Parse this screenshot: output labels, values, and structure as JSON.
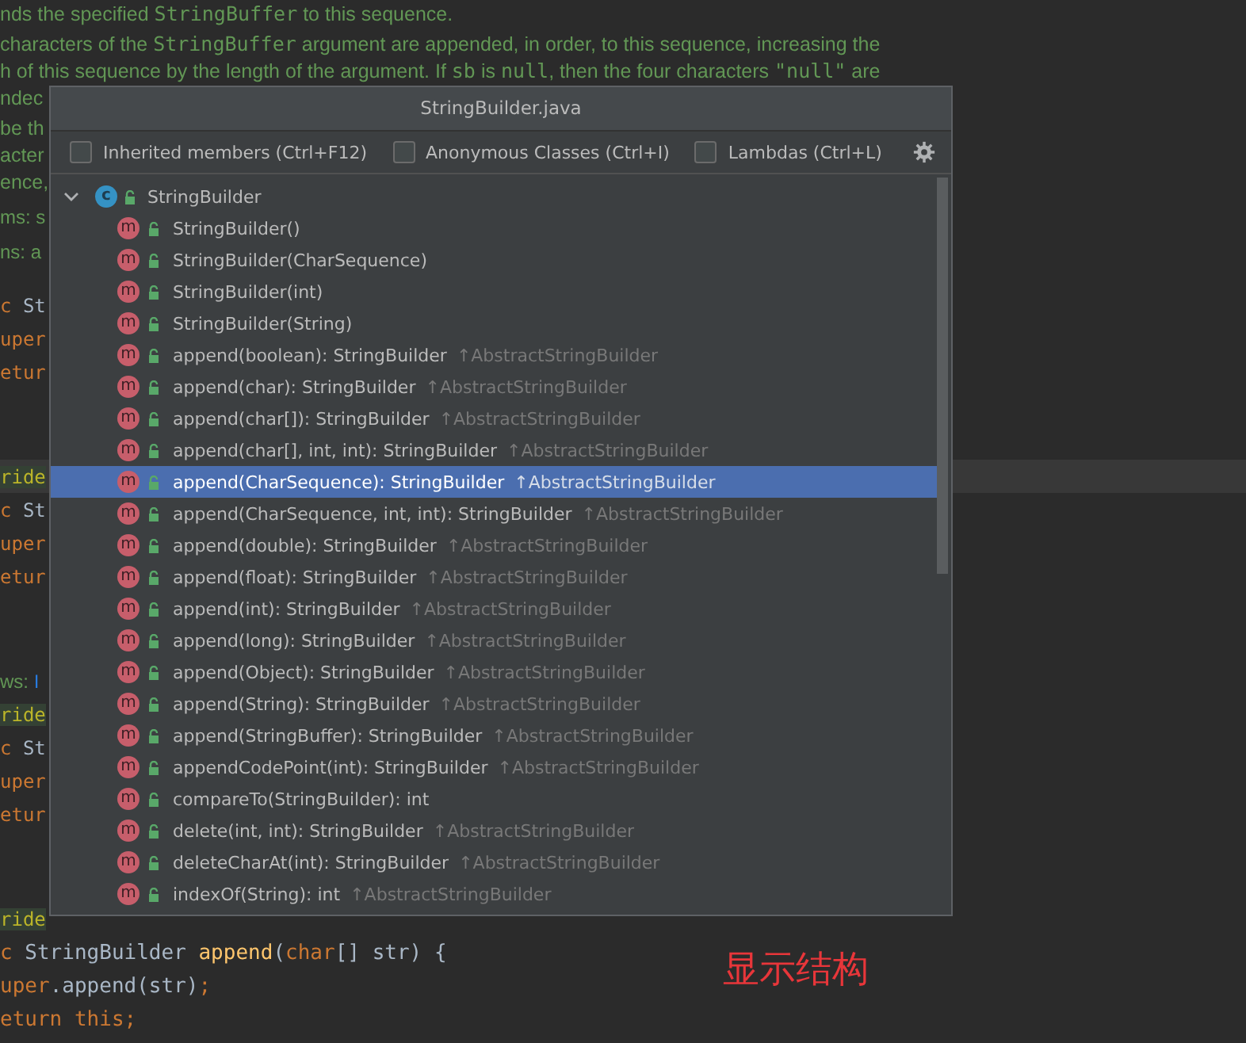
{
  "editor": {
    "blocks": [
      {
        "kind": "doc",
        "lines": [
          {
            "current": false,
            "segments": [
              {
                "text": "nds the specified ",
                "kind": "doc"
              },
              {
                "text": "StringBuffer",
                "kind": "doc-code"
              },
              {
                "text": " to this sequence.",
                "kind": "doc"
              }
            ]
          }
        ]
      },
      {
        "kind": "doc",
        "lines": [
          {
            "current": false,
            "segments": [
              {
                "text": "characters of the ",
                "kind": "doc"
              },
              {
                "text": "StringBuffer",
                "kind": "doc-code"
              },
              {
                "text": " argument are appended, in order, to this sequence, increasing the",
                "kind": "doc"
              }
            ]
          },
          {
            "current": false,
            "segments": [
              {
                "text": "h of this sequence by the length of the argument. If ",
                "kind": "doc"
              },
              {
                "text": "sb",
                "kind": "doc-code"
              },
              {
                "text": " is ",
                "kind": "doc"
              },
              {
                "text": "null",
                "kind": "doc-code"
              },
              {
                "text": ", then the four characters ",
                "kind": "doc"
              },
              {
                "text": "\"null\"",
                "kind": "doc-code"
              },
              {
                "text": " are",
                "kind": "doc"
              }
            ]
          },
          {
            "current": false,
            "segments": [
              {
                "text": "ndec",
                "kind": "doc"
              }
            ]
          }
        ]
      },
      {
        "kind": "doc",
        "lines": [
          {
            "current": false,
            "segments": [
              {
                "text": "be th",
                "kind": "doc"
              }
            ]
          },
          {
            "current": false,
            "segments": [
              {
                "text": "acter",
                "kind": "doc"
              }
            ]
          },
          {
            "current": false,
            "segments": [
              {
                "text": "ence,",
                "kind": "doc"
              }
            ]
          }
        ]
      },
      {
        "kind": "doc",
        "lines": [
          {
            "current": false,
            "segments": [
              {
                "text": "ms: s",
                "kind": "doc-tag"
              }
            ]
          }
        ]
      },
      {
        "kind": "doc",
        "lines": [
          {
            "current": false,
            "segments": [
              {
                "text": "ns: a",
                "kind": "doc-tag"
              }
            ]
          }
        ]
      },
      {
        "kind": "code",
        "lines": [
          {
            "current": false,
            "segments": [
              {
                "text": "c ",
                "kind": "keyword"
              },
              {
                "text": "St",
                "kind": "plain"
              }
            ]
          },
          {
            "current": false,
            "segments": [
              {
                "text": "uper",
                "kind": "keyword"
              }
            ]
          },
          {
            "current": false,
            "segments": [
              {
                "text": "etur",
                "kind": "keyword"
              }
            ]
          }
        ]
      },
      {
        "kind": "code",
        "lines": [
          {
            "current": true,
            "segments": [
              {
                "text": "ride",
                "kind": "annotation"
              }
            ]
          },
          {
            "current": false,
            "segments": [
              {
                "text": "c ",
                "kind": "keyword"
              },
              {
                "text": "St",
                "kind": "plain"
              }
            ]
          },
          {
            "current": false,
            "segments": [
              {
                "text": "uper",
                "kind": "keyword"
              }
            ]
          },
          {
            "current": false,
            "segments": [
              {
                "text": "etur",
                "kind": "keyword"
              }
            ]
          }
        ]
      },
      {
        "kind": "code",
        "lines": [
          {
            "current": false,
            "segments": [
              {
                "text": "ws: ",
                "kind": "doc-tag"
              },
              {
                "text": "I",
                "kind": "link"
              }
            ]
          },
          {
            "current": false,
            "segments": [
              {
                "text": "ride",
                "kind": "annotation"
              }
            ]
          },
          {
            "current": false,
            "segments": [
              {
                "text": "c ",
                "kind": "keyword"
              },
              {
                "text": "St",
                "kind": "plain"
              }
            ]
          },
          {
            "current": false,
            "segments": [
              {
                "text": "uper",
                "kind": "keyword"
              }
            ]
          },
          {
            "current": false,
            "segments": [
              {
                "text": "etur",
                "kind": "keyword"
              }
            ]
          }
        ]
      },
      {
        "kind": "code",
        "lines": [
          {
            "current": false,
            "segments": [
              {
                "text": "ride",
                "kind": "annotation"
              }
            ]
          },
          {
            "current": false,
            "segments": [
              {
                "text": "c ",
                "kind": "keyword"
              },
              {
                "text": "StringBuilder ",
                "kind": "plain"
              },
              {
                "text": "append",
                "kind": "method"
              },
              {
                "text": "(",
                "kind": "plain"
              },
              {
                "text": "char",
                "kind": "keyword"
              },
              {
                "text": "[] str) {",
                "kind": "plain"
              }
            ]
          },
          {
            "current": false,
            "segments": [
              {
                "text": "uper",
                "kind": "keyword"
              },
              {
                "text": ".append(str)",
                "kind": "plain"
              },
              {
                "text": ";",
                "kind": "keyword"
              }
            ]
          },
          {
            "current": false,
            "segments": [
              {
                "text": "eturn this",
                "kind": "keyword"
              },
              {
                "text": ";",
                "kind": "keyword"
              }
            ]
          }
        ]
      }
    ]
  },
  "annotation": "显示结构",
  "popup": {
    "title": "StringBuilder.java",
    "options": [
      {
        "label": "Inherited members (Ctrl+F12)",
        "checked": false
      },
      {
        "label": "Anonymous Classes (Ctrl+I)",
        "checked": false
      },
      {
        "label": "Lambdas (Ctrl+L)",
        "checked": false
      }
    ],
    "tree": {
      "kind": "class",
      "icon": "c",
      "label": "StringBuilder",
      "expanded": true,
      "children": [
        {
          "kind": "method",
          "icon": "m",
          "label": "StringBuilder()",
          "selected": false
        },
        {
          "kind": "method",
          "icon": "m",
          "label": "StringBuilder(CharSequence)",
          "selected": false
        },
        {
          "kind": "method",
          "icon": "m",
          "label": "StringBuilder(int)",
          "selected": false
        },
        {
          "kind": "method",
          "icon": "m",
          "label": "StringBuilder(String)",
          "selected": false
        },
        {
          "kind": "method",
          "icon": "m",
          "label": "append(boolean): StringBuilder",
          "inherited": "↑AbstractStringBuilder",
          "selected": false
        },
        {
          "kind": "method",
          "icon": "m",
          "label": "append(char): StringBuilder",
          "inherited": "↑AbstractStringBuilder",
          "selected": false
        },
        {
          "kind": "method",
          "icon": "m",
          "label": "append(char[]): StringBuilder",
          "inherited": "↑AbstractStringBuilder",
          "selected": false
        },
        {
          "kind": "method",
          "icon": "m",
          "label": "append(char[], int, int): StringBuilder",
          "inherited": "↑AbstractStringBuilder",
          "selected": false
        },
        {
          "kind": "method",
          "icon": "m",
          "label": "append(CharSequence): StringBuilder",
          "inherited": "↑AbstractStringBuilder",
          "selected": true
        },
        {
          "kind": "method",
          "icon": "m",
          "label": "append(CharSequence, int, int): StringBuilder",
          "inherited": "↑AbstractStringBuilder",
          "selected": false
        },
        {
          "kind": "method",
          "icon": "m",
          "label": "append(double): StringBuilder",
          "inherited": "↑AbstractStringBuilder",
          "selected": false
        },
        {
          "kind": "method",
          "icon": "m",
          "label": "append(float): StringBuilder",
          "inherited": "↑AbstractStringBuilder",
          "selected": false
        },
        {
          "kind": "method",
          "icon": "m",
          "label": "append(int): StringBuilder",
          "inherited": "↑AbstractStringBuilder",
          "selected": false
        },
        {
          "kind": "method",
          "icon": "m",
          "label": "append(long): StringBuilder",
          "inherited": "↑AbstractStringBuilder",
          "selected": false
        },
        {
          "kind": "method",
          "icon": "m",
          "label": "append(Object): StringBuilder",
          "inherited": "↑AbstractStringBuilder",
          "selected": false
        },
        {
          "kind": "method",
          "icon": "m",
          "label": "append(String): StringBuilder",
          "inherited": "↑AbstractStringBuilder",
          "selected": false
        },
        {
          "kind": "method",
          "icon": "m",
          "label": "append(StringBuffer): StringBuilder",
          "inherited": "↑AbstractStringBuilder",
          "selected": false
        },
        {
          "kind": "method",
          "icon": "m",
          "label": "appendCodePoint(int): StringBuilder",
          "inherited": "↑AbstractStringBuilder",
          "selected": false
        },
        {
          "kind": "method",
          "icon": "m",
          "label": "compareTo(StringBuilder): int",
          "selected": false
        },
        {
          "kind": "method",
          "icon": "m",
          "label": "delete(int, int): StringBuilder",
          "inherited": "↑AbstractStringBuilder",
          "selected": false
        },
        {
          "kind": "method",
          "icon": "m",
          "label": "deleteCharAt(int): StringBuilder",
          "inherited": "↑AbstractStringBuilder",
          "selected": false
        },
        {
          "kind": "method",
          "icon": "m",
          "label": "indexOf(String): int",
          "inherited": "↑AbstractStringBuilder",
          "selected": false
        }
      ]
    }
  }
}
